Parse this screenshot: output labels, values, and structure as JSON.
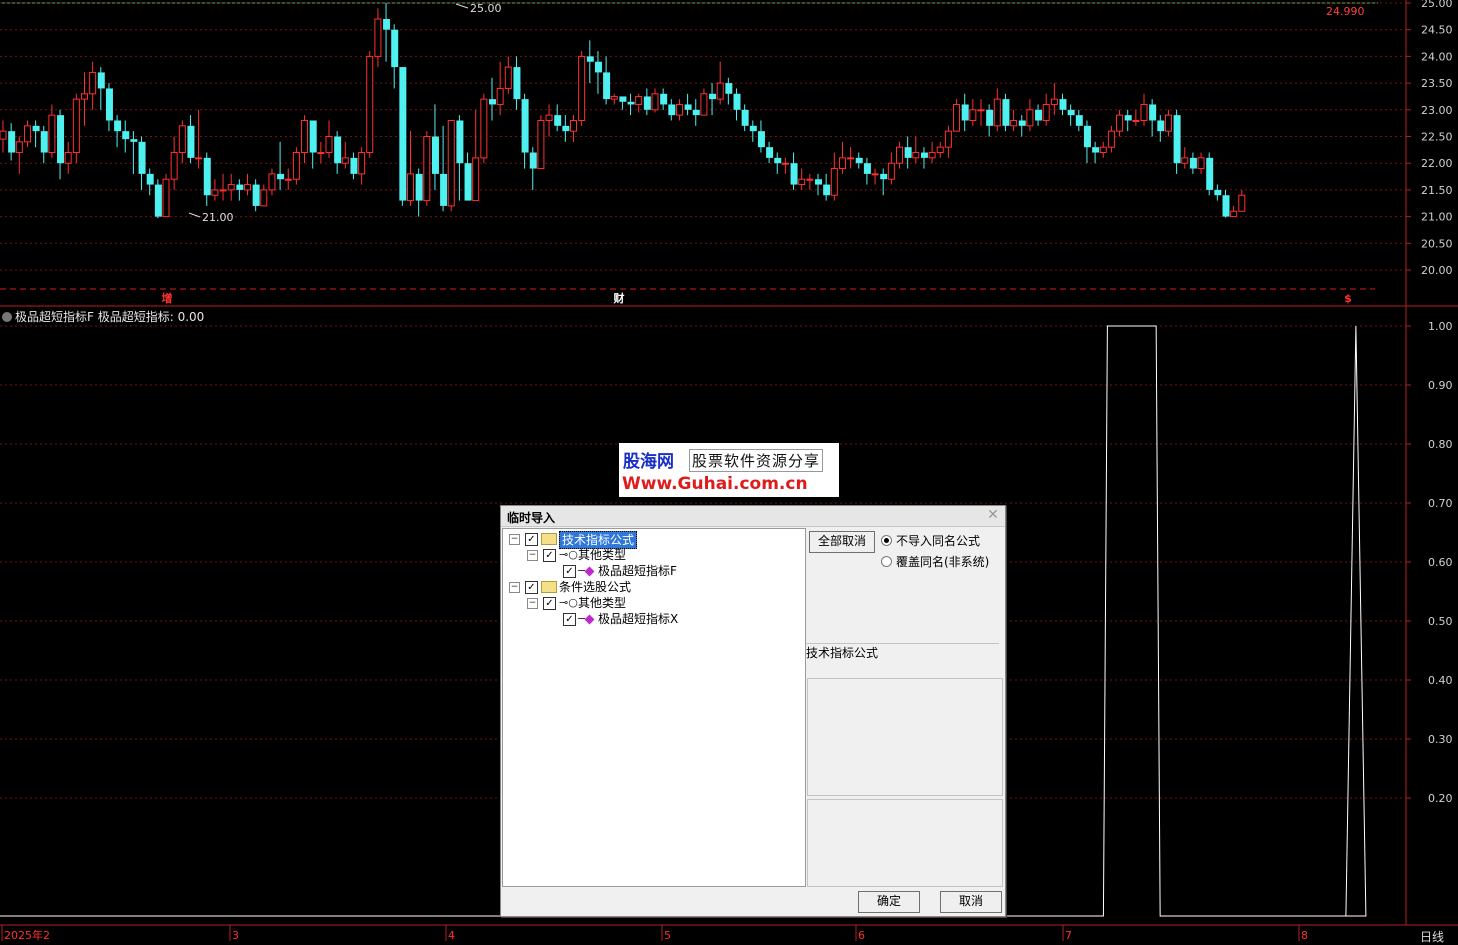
{
  "colors": {
    "background": "#000000",
    "up": "#ff3030",
    "down": "#4ff0f0",
    "grid": "#7a1010",
    "axis_text": "#d0d0d0",
    "indicator_line": "#ffffff"
  },
  "price_panel": {
    "y_ticks": [
      "25.00",
      "24.50",
      "24.00",
      "23.50",
      "23.00",
      "22.50",
      "22.00",
      "21.50",
      "21.00",
      "20.50",
      "20.00"
    ],
    "last_price": "24.990",
    "high_marker": "25.00",
    "low_marker": "21.00",
    "event_markers": [
      "增",
      "财",
      "$"
    ]
  },
  "indicator_panel": {
    "title_name": "极品超短指标F",
    "title_value": "极品超短指标: 0.00",
    "y_ticks": [
      "1.00",
      "0.90",
      "0.80",
      "0.70",
      "0.60",
      "0.50",
      "0.40",
      "0.30",
      "0.20"
    ]
  },
  "x_axis": {
    "labels": [
      "2025年2",
      "3",
      "4",
      "5",
      "6",
      "7",
      "8"
    ],
    "period": "日线"
  },
  "watermark": {
    "brand": "股海网",
    "tagline": "股票软件资源分享",
    "url": "Www.Guhai.com.cn"
  },
  "dialog": {
    "title": "临时导入",
    "tree": [
      {
        "label": "技术指标公式",
        "level": 0,
        "kind": "folder",
        "selected": true
      },
      {
        "label": "其他类型",
        "level": 1,
        "kind": "key"
      },
      {
        "label": "极品超短指标F",
        "level": 2,
        "kind": "formula"
      },
      {
        "label": "条件选股公式",
        "level": 0,
        "kind": "folder"
      },
      {
        "label": "其他类型",
        "level": 1,
        "kind": "key"
      },
      {
        "label": "极品超短指标X",
        "level": 2,
        "kind": "formula"
      }
    ],
    "cancel_all_label": "全部取消",
    "radio_no_import": "不导入同名公式",
    "radio_overwrite": "覆盖同名(非系统)",
    "selected_radio": "不导入同名公式",
    "info_label": "技术指标公式",
    "ok_label": "确定",
    "cancel_label": "取消"
  },
  "chart_data": {
    "type": "candlestick",
    "ylim": [
      19.9,
      25.0
    ],
    "last_price": 24.99,
    "candles": [
      [
        22.45,
        22.6,
        22.2,
        22.8
      ],
      [
        22.6,
        22.2,
        22.05,
        22.75
      ],
      [
        22.2,
        22.4,
        21.8,
        22.5
      ],
      [
        22.4,
        22.7,
        22.3,
        22.8
      ],
      [
        22.7,
        22.6,
        22.3,
        22.8
      ],
      [
        22.6,
        22.2,
        22.0,
        22.7
      ],
      [
        22.2,
        22.9,
        22.1,
        23.1
      ],
      [
        22.9,
        22.0,
        21.7,
        23.0
      ],
      [
        22.0,
        22.2,
        21.8,
        22.4
      ],
      [
        22.2,
        23.2,
        22.0,
        23.3
      ],
      [
        23.2,
        23.3,
        22.7,
        23.7
      ],
      [
        23.3,
        23.7,
        23.0,
        23.9
      ],
      [
        23.7,
        23.4,
        23.0,
        23.8
      ],
      [
        23.4,
        22.8,
        22.6,
        23.5
      ],
      [
        22.8,
        22.6,
        22.3,
        22.9
      ],
      [
        22.6,
        22.45,
        22.2,
        22.8
      ],
      [
        22.45,
        22.4,
        21.8,
        22.6
      ],
      [
        22.4,
        21.8,
        21.5,
        22.5
      ],
      [
        21.8,
        21.6,
        21.4,
        21.9
      ],
      [
        21.6,
        21.0,
        20.97,
        21.7
      ],
      [
        21.0,
        21.7,
        21.0,
        21.8
      ],
      [
        21.7,
        22.2,
        21.5,
        22.5
      ],
      [
        22.2,
        22.7,
        22.0,
        22.8
      ],
      [
        22.7,
        22.1,
        22.0,
        22.9
      ],
      [
        22.1,
        22.1,
        21.9,
        23.0
      ],
      [
        22.1,
        21.4,
        21.2,
        22.2
      ],
      [
        21.4,
        21.5,
        21.3,
        21.7
      ],
      [
        21.5,
        21.5,
        21.3,
        21.8
      ],
      [
        21.5,
        21.6,
        21.3,
        21.8
      ],
      [
        21.6,
        21.5,
        21.3,
        21.7
      ],
      [
        21.5,
        21.6,
        21.4,
        21.8
      ],
      [
        21.6,
        21.2,
        21.1,
        21.7
      ],
      [
        21.2,
        21.5,
        21.2,
        21.6
      ],
      [
        21.5,
        21.8,
        21.4,
        21.9
      ],
      [
        21.8,
        21.7,
        21.5,
        22.4
      ],
      [
        21.7,
        21.7,
        21.5,
        21.9
      ],
      [
        21.7,
        22.2,
        21.6,
        22.3
      ],
      [
        22.2,
        22.8,
        22.0,
        22.9
      ],
      [
        22.8,
        22.2,
        21.9,
        22.8
      ],
      [
        22.2,
        22.2,
        22.0,
        22.4
      ],
      [
        22.2,
        22.5,
        22.1,
        22.8
      ],
      [
        22.5,
        22.0,
        21.8,
        22.6
      ],
      [
        22.0,
        22.1,
        21.9,
        22.4
      ],
      [
        22.1,
        21.8,
        21.7,
        22.2
      ],
      [
        21.8,
        22.2,
        21.6,
        22.3
      ],
      [
        22.2,
        24.0,
        22.1,
        24.1
      ],
      [
        24.0,
        24.7,
        23.8,
        24.9
      ],
      [
        24.7,
        24.5,
        23.9,
        25.0
      ],
      [
        24.5,
        23.8,
        23.4,
        24.6
      ],
      [
        23.8,
        21.3,
        21.2,
        23.8
      ],
      [
        21.3,
        21.8,
        21.2,
        22.6
      ],
      [
        21.8,
        21.3,
        21.0,
        21.9
      ],
      [
        21.3,
        22.5,
        21.2,
        22.6
      ],
      [
        22.5,
        21.8,
        21.5,
        23.1
      ],
      [
        21.8,
        21.2,
        21.1,
        22.7
      ],
      [
        21.2,
        22.8,
        21.1,
        22.8
      ],
      [
        22.8,
        22.0,
        21.3,
        22.9
      ],
      [
        22.0,
        21.3,
        21.3,
        22.2
      ],
      [
        21.3,
        22.1,
        21.3,
        23.0
      ],
      [
        22.1,
        23.2,
        22.0,
        23.3
      ],
      [
        23.2,
        23.1,
        22.8,
        23.6
      ],
      [
        23.1,
        23.4,
        22.9,
        23.9
      ],
      [
        23.4,
        23.8,
        23.3,
        24.0
      ],
      [
        23.8,
        23.2,
        23.0,
        24.0
      ],
      [
        23.2,
        22.2,
        21.9,
        23.3
      ],
      [
        22.2,
        21.9,
        21.5,
        22.3
      ],
      [
        21.9,
        22.8,
        21.9,
        22.9
      ],
      [
        22.8,
        22.9,
        22.5,
        23.1
      ],
      [
        22.9,
        22.7,
        22.6,
        23.1
      ],
      [
        22.7,
        22.6,
        22.4,
        22.9
      ],
      [
        22.6,
        22.8,
        22.4,
        22.9
      ],
      [
        22.8,
        24.0,
        22.7,
        24.1
      ],
      [
        24.0,
        23.9,
        23.5,
        24.3
      ],
      [
        23.9,
        23.7,
        23.3,
        24.1
      ],
      [
        23.7,
        23.2,
        23.1,
        24.0
      ],
      [
        23.2,
        23.25,
        23.1,
        23.3
      ],
      [
        23.25,
        23.15,
        23.0,
        23.25
      ],
      [
        23.15,
        23.1,
        22.9,
        23.3
      ],
      [
        23.1,
        23.25,
        22.95,
        23.3
      ],
      [
        23.25,
        23.0,
        22.9,
        23.4
      ],
      [
        23.0,
        23.3,
        22.95,
        23.4
      ],
      [
        23.3,
        23.1,
        23.0,
        23.4
      ],
      [
        23.1,
        22.9,
        22.8,
        23.2
      ],
      [
        22.9,
        23.1,
        22.8,
        23.2
      ],
      [
        23.1,
        23.0,
        22.9,
        23.3
      ],
      [
        23.0,
        22.9,
        22.7,
        23.2
      ],
      [
        22.9,
        23.3,
        22.9,
        23.4
      ],
      [
        23.3,
        23.2,
        22.9,
        23.5
      ],
      [
        23.2,
        23.5,
        23.1,
        23.9
      ],
      [
        23.5,
        23.3,
        23.1,
        23.6
      ],
      [
        23.3,
        23.0,
        22.8,
        23.4
      ],
      [
        23.0,
        22.7,
        22.6,
        23.1
      ],
      [
        22.7,
        22.6,
        22.4,
        22.8
      ],
      [
        22.6,
        22.3,
        22.2,
        22.8
      ],
      [
        22.3,
        22.1,
        22.0,
        22.4
      ],
      [
        22.1,
        22.0,
        21.8,
        22.2
      ],
      [
        22.0,
        22.0,
        21.8,
        22.1
      ],
      [
        22.0,
        21.6,
        21.5,
        22.2
      ],
      [
        21.6,
        21.7,
        21.5,
        21.9
      ],
      [
        21.7,
        21.7,
        21.5,
        21.8
      ],
      [
        21.7,
        21.6,
        21.4,
        21.8
      ],
      [
        21.6,
        21.4,
        21.3,
        21.8
      ],
      [
        21.4,
        21.9,
        21.3,
        22.2
      ],
      [
        21.9,
        22.1,
        21.8,
        22.4
      ],
      [
        22.1,
        22.1,
        21.9,
        22.3
      ],
      [
        22.1,
        22.0,
        21.9,
        22.2
      ],
      [
        22.0,
        21.8,
        21.6,
        22.1
      ],
      [
        21.8,
        21.8,
        21.6,
        21.9
      ],
      [
        21.8,
        21.7,
        21.4,
        21.9
      ],
      [
        21.7,
        22.0,
        21.6,
        22.2
      ],
      [
        22.0,
        22.3,
        21.9,
        22.4
      ],
      [
        22.3,
        22.1,
        21.9,
        22.5
      ],
      [
        22.1,
        22.2,
        22.0,
        22.5
      ],
      [
        22.2,
        22.1,
        21.9,
        22.3
      ],
      [
        22.1,
        22.2,
        22.0,
        22.4
      ],
      [
        22.2,
        22.3,
        22.1,
        22.4
      ],
      [
        22.3,
        22.6,
        22.1,
        22.7
      ],
      [
        22.6,
        23.1,
        22.6,
        23.2
      ],
      [
        23.1,
        22.8,
        22.6,
        23.3
      ],
      [
        22.8,
        23.0,
        22.7,
        23.2
      ],
      [
        23.0,
        23.0,
        22.7,
        23.2
      ],
      [
        23.0,
        22.7,
        22.5,
        23.1
      ],
      [
        22.7,
        23.2,
        22.6,
        23.4
      ],
      [
        23.2,
        22.7,
        22.6,
        23.3
      ],
      [
        22.7,
        22.8,
        22.6,
        23.0
      ],
      [
        22.8,
        22.7,
        22.5,
        22.9
      ],
      [
        22.7,
        23.0,
        22.6,
        23.2
      ],
      [
        23.0,
        22.8,
        22.7,
        23.1
      ],
      [
        22.8,
        23.1,
        22.7,
        23.3
      ],
      [
        23.1,
        23.2,
        22.9,
        23.5
      ],
      [
        23.2,
        23.0,
        22.9,
        23.3
      ],
      [
        23.0,
        22.9,
        22.7,
        23.1
      ],
      [
        22.9,
        22.7,
        22.6,
        23.0
      ],
      [
        22.7,
        22.3,
        22.0,
        22.8
      ],
      [
        22.3,
        22.2,
        22.0,
        22.4
      ],
      [
        22.2,
        22.3,
        22.1,
        22.4
      ],
      [
        22.3,
        22.6,
        22.2,
        22.7
      ],
      [
        22.6,
        22.9,
        22.5,
        23.0
      ],
      [
        22.9,
        22.8,
        22.6,
        23.0
      ],
      [
        22.8,
        22.8,
        22.7,
        23.0
      ],
      [
        22.8,
        23.1,
        22.7,
        23.3
      ],
      [
        23.1,
        22.8,
        22.5,
        23.2
      ],
      [
        22.8,
        22.6,
        22.4,
        22.9
      ],
      [
        22.6,
        22.9,
        22.5,
        23.0
      ],
      [
        22.9,
        22.0,
        21.8,
        23.0
      ],
      [
        22.0,
        22.1,
        21.9,
        22.3
      ],
      [
        22.1,
        21.9,
        21.8,
        22.2
      ],
      [
        21.9,
        22.1,
        21.8,
        22.2
      ],
      [
        22.1,
        21.5,
        21.4,
        22.2
      ],
      [
        21.5,
        21.4,
        21.3,
        21.6
      ],
      [
        21.4,
        21.0,
        20.98,
        21.5
      ],
      [
        21.0,
        21.1,
        21.0,
        21.2
      ],
      [
        21.1,
        21.4,
        21.3,
        21.5
      ]
    ],
    "indicator": {
      "name": "极品超短指标",
      "ylim": [
        0,
        1.05
      ],
      "pulses": [
        {
          "start_candle": 136,
          "end_candle": 141,
          "value": 1.0
        },
        {
          "start_candle": 166,
          "end_candle": 166,
          "value": 1.0
        }
      ]
    }
  }
}
